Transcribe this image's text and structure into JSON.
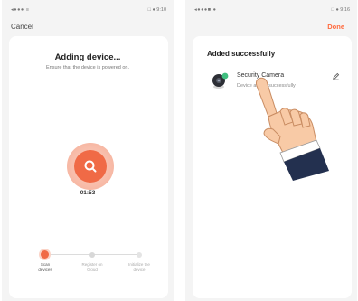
{
  "left": {
    "status": {
      "signal": "◂●●● ≡",
      "time": "□ ● 9:10"
    },
    "nav": {
      "cancel_label": "Cancel"
    },
    "title": "Adding device...",
    "subtitle": "Ensure that the device is powered on.",
    "scan": {
      "icon": "search-icon",
      "color": "#f06a46"
    },
    "timer": "01:53",
    "steps": [
      {
        "line1": "Scan",
        "line2": "devices",
        "state": "active"
      },
      {
        "line1": "Register on",
        "line2": "Cloud",
        "state": "pending"
      },
      {
        "line1": "Initialize the",
        "line2": "device",
        "state": "pending"
      }
    ]
  },
  "right": {
    "status": {
      "signal": "◂●●●■ ●",
      "time": "□ ● 9:16"
    },
    "nav": {
      "done_label": "Done"
    },
    "title": "Added successfully",
    "device": {
      "name": "Security Camera",
      "status": "Device added successfully",
      "icon": "camera-icon",
      "edit_icon": "pencil-icon"
    }
  },
  "colors": {
    "accent": "#f06a46",
    "success_dot": "#3fbf7f",
    "done": "#ff6a3d"
  }
}
